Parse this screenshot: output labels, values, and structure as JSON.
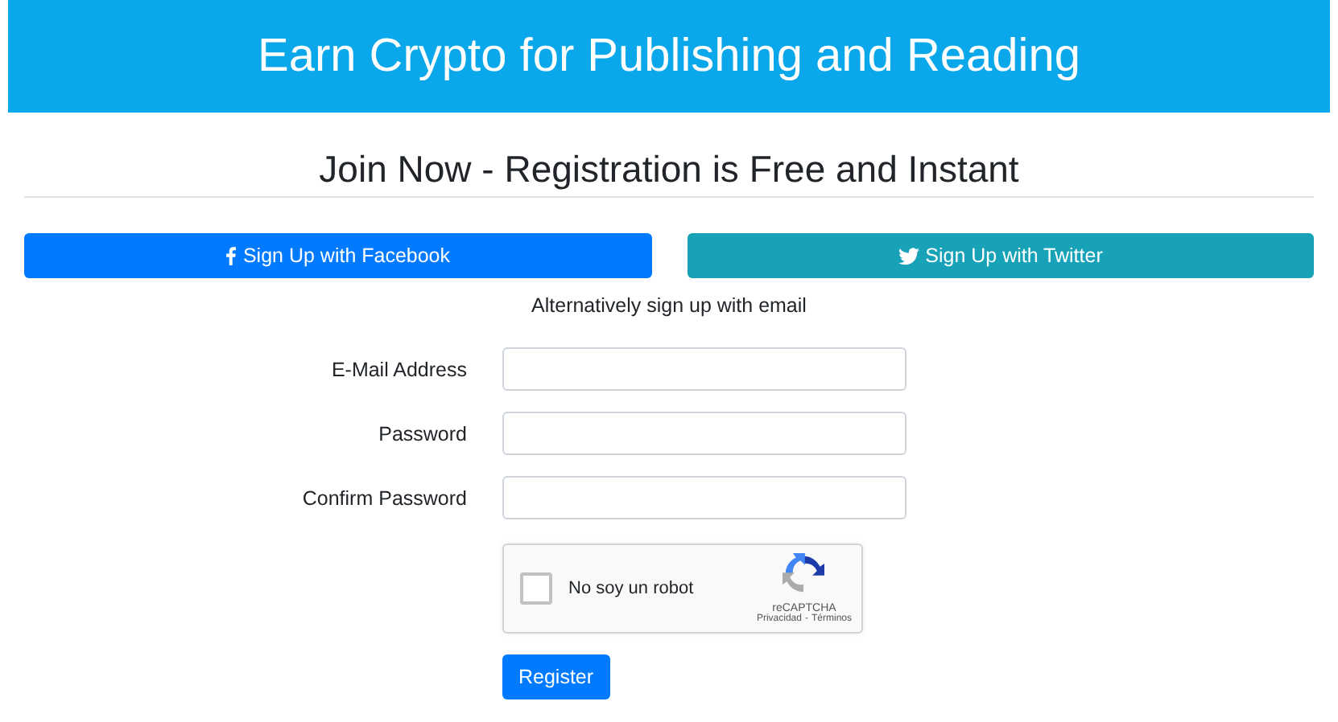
{
  "banner": {
    "title": "Earn Crypto for Publishing and Reading"
  },
  "heading": "Join Now - Registration is Free and Instant",
  "social_buttons": [
    {
      "kind": "facebook",
      "label": "Sign Up with Facebook"
    },
    {
      "kind": "twitter",
      "label": "Sign Up with Twitter"
    }
  ],
  "alternative_text": "Alternatively sign up with email",
  "fields": [
    {
      "label": "E-Mail Address"
    },
    {
      "label": "Password"
    },
    {
      "label": "Confirm Password"
    }
  ],
  "captcha": {
    "label": "No soy un robot",
    "checked": false,
    "brand": "reCAPTCHA",
    "links": [
      "Privacidad",
      "Términos"
    ],
    "separator": "-"
  },
  "submit_button": "Register"
}
